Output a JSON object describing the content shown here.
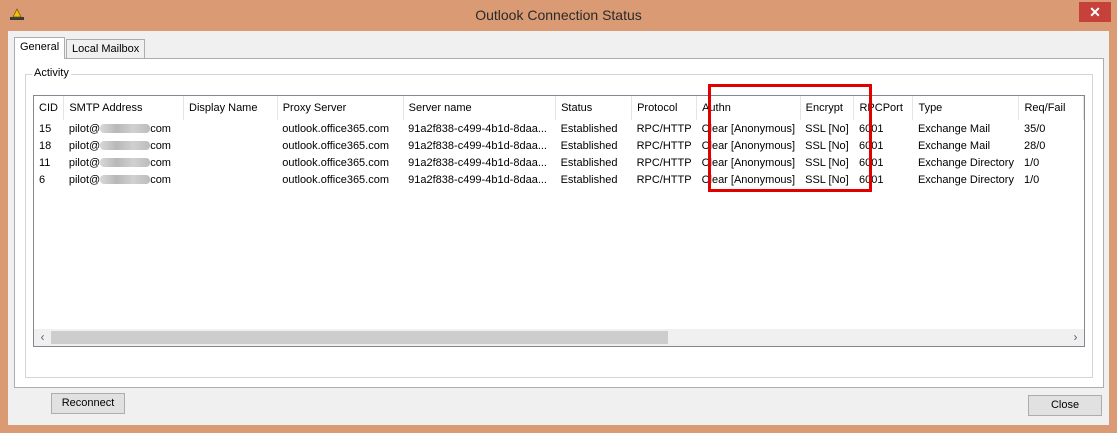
{
  "window": {
    "title": "Outlook Connection Status"
  },
  "tabs": [
    {
      "label": "General"
    },
    {
      "label": "Local Mailbox"
    }
  ],
  "group": {
    "label": "Activity"
  },
  "columns": [
    "CID",
    "SMTP Address",
    "Display Name",
    "Proxy Server",
    "Server name",
    "Status",
    "Protocol",
    "Authn",
    "Encrypt",
    "RPCPort",
    "Type",
    "Req/Fail"
  ],
  "rows": [
    {
      "cid": "15",
      "smtp_prefix": "pilot@",
      "smtp_suffix": "com",
      "display": "",
      "proxy": "outlook.office365.com",
      "server": "91a2f838-c499-4b1d-8daa...",
      "status": "Established",
      "protocol": "RPC/HTTP",
      "authn": "Clear [Anonymous]",
      "encrypt": "SSL [No]",
      "port": "6001",
      "type": "Exchange Mail",
      "reqfail": "35/0"
    },
    {
      "cid": "18",
      "smtp_prefix": "pilot@",
      "smtp_suffix": "com",
      "display": "",
      "proxy": "outlook.office365.com",
      "server": "91a2f838-c499-4b1d-8daa...",
      "status": "Established",
      "protocol": "RPC/HTTP",
      "authn": "Clear [Anonymous]",
      "encrypt": "SSL [No]",
      "port": "6001",
      "type": "Exchange Mail",
      "reqfail": "28/0"
    },
    {
      "cid": "11",
      "smtp_prefix": "pilot@",
      "smtp_suffix": "com",
      "display": "",
      "proxy": "outlook.office365.com",
      "server": "91a2f838-c499-4b1d-8daa...",
      "status": "Established",
      "protocol": "RPC/HTTP",
      "authn": "Clear [Anonymous]",
      "encrypt": "SSL [No]",
      "port": "6001",
      "type": "Exchange Directory",
      "reqfail": "1/0"
    },
    {
      "cid": "6",
      "smtp_prefix": "pilot@",
      "smtp_suffix": "com",
      "display": "",
      "proxy": "outlook.office365.com",
      "server": "91a2f838-c499-4b1d-8daa...",
      "status": "Established",
      "protocol": "RPC/HTTP",
      "authn": "Clear [Anonymous]",
      "encrypt": "SSL [No]",
      "port": "6001",
      "type": "Exchange Directory",
      "reqfail": "1/0"
    }
  ],
  "buttons": {
    "reconnect": "Reconnect",
    "close": "Close"
  },
  "scroll": {
    "left_arrow": "‹",
    "right_arrow": "›"
  },
  "colors": {
    "window_frame": "#d99a74",
    "close_button": "#c7413b",
    "highlight": "#e00000"
  },
  "icons": {
    "app": "outlook-tray-icon",
    "close": "close-icon"
  }
}
